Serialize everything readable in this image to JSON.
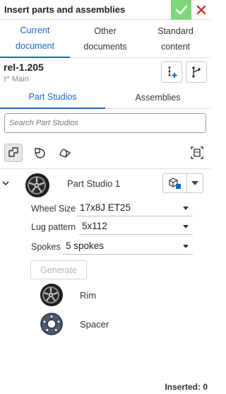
{
  "header": {
    "title": "Insert parts and assemblies",
    "ok_icon": "check-icon",
    "close_icon": "close-icon",
    "ok_color": "#7ed77a",
    "close_color": "#d9332f"
  },
  "doc_tabs": [
    {
      "line1": "Current",
      "line2": "document",
      "active": true
    },
    {
      "line1": "Other",
      "line2": "documents",
      "active": false
    },
    {
      "line1": "Standard",
      "line2": "content",
      "active": false
    }
  ],
  "document": {
    "name": "rel-1.205",
    "branch": "Main",
    "branch_icon": "branch-icon",
    "actions": [
      "insert-version-icon",
      "branch-graph-icon"
    ]
  },
  "studio_tabs": [
    {
      "label": "Part Studios",
      "active": true
    },
    {
      "label": "Assemblies",
      "active": false
    }
  ],
  "search": {
    "placeholder": "Search Part Studios",
    "value": ""
  },
  "filters": [
    {
      "icon": "part-filter-icon",
      "active": true
    },
    {
      "icon": "surface-filter-icon",
      "active": false
    },
    {
      "icon": "curve-filter-icon",
      "active": false
    },
    {
      "icon": "select-all-icon",
      "active": false
    }
  ],
  "item": {
    "name": "Part Studio 1",
    "expanded": true,
    "thumbnail": "wheel-thumbnail",
    "config": [
      {
        "label": "Wheel Size",
        "value": "17x8J ET25"
      },
      {
        "label": "Lug pattern",
        "value": "5x112"
      },
      {
        "label": "Spokes",
        "value": "5 spokes"
      }
    ],
    "generate_label": "Generate",
    "parts": [
      {
        "name": "Rim",
        "thumbnail": "rim-thumbnail"
      },
      {
        "name": "Spacer",
        "thumbnail": "spacer-thumbnail"
      }
    ]
  },
  "accent": "#1a63c4",
  "footer": {
    "inserted_label": "Inserted: 0"
  }
}
